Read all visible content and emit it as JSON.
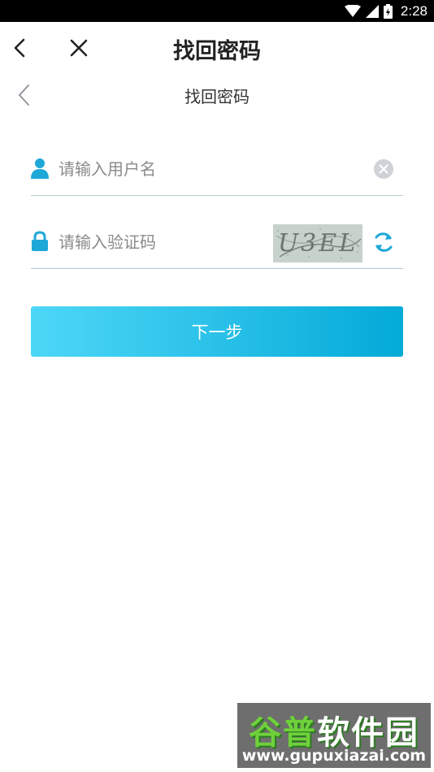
{
  "status_bar": {
    "time": "2:28",
    "icons": [
      "wifi-icon",
      "signal-icon",
      "battery-icon"
    ]
  },
  "app_header": {
    "title": "找回密码",
    "back_icon": "chevron-left-icon",
    "close_icon": "close-icon"
  },
  "page_header": {
    "title": "找回密码",
    "back_icon": "chevron-left-icon"
  },
  "form": {
    "username": {
      "value": "",
      "placeholder": "请输入用户名",
      "icon": "user-icon",
      "clear_icon": "clear-circle-icon"
    },
    "captcha": {
      "value": "",
      "placeholder": "请输入验证码",
      "icon": "lock-icon",
      "captcha_text": "U3EL",
      "refresh_icon": "refresh-icon"
    },
    "next_label": "下一步"
  },
  "watermark": {
    "name_part1": "谷普",
    "name_part2": "软件园",
    "url": "www.gupuxiazai.com"
  },
  "colors": {
    "accent": "#1EA8D8",
    "button_gradient_start": "#4DD7F7",
    "button_gradient_end": "#03AAD8",
    "status_bar": "#000000"
  }
}
